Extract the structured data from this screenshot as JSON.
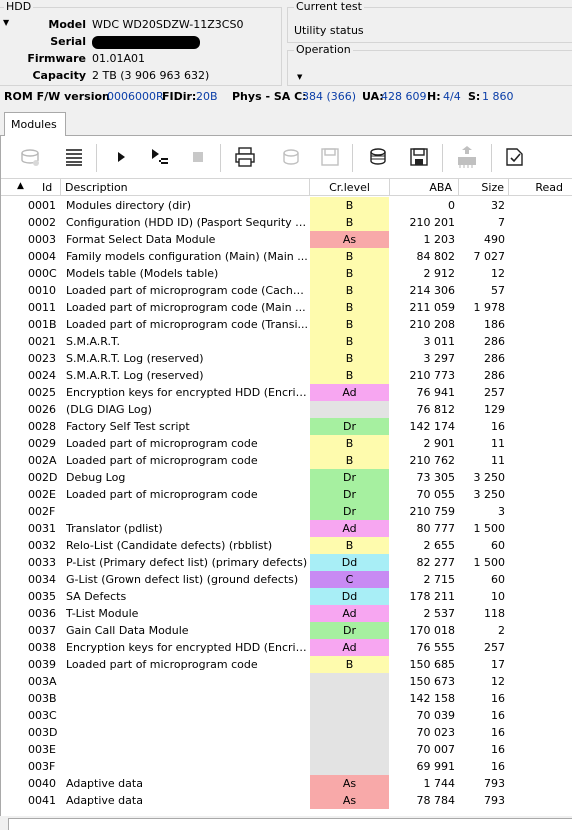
{
  "hdd": {
    "title": "HDD",
    "model_label": "Model",
    "model": "WDC WD20SDZW-11Z3CS0",
    "serial_label": "Serial",
    "firmware_label": "Firmware",
    "firmware": "01.01A01",
    "capacity_label": "Capacity",
    "capacity": "2 TB (3 906 963 632)"
  },
  "current_test": {
    "title": "Current test",
    "status": "Utility status"
  },
  "operation": {
    "title": "Operation"
  },
  "fw": {
    "rom_label": "ROM F/W version",
    "rom": "0006000R",
    "fdir_label": "FIDir:",
    "fdir": "20B",
    "phys_label": "Phys - SA C:",
    "phys": "384 (366)",
    "ua_label": "UA:",
    "ua": "428 609",
    "h_label": "H:",
    "h": "4/4",
    "s_label": "S:",
    "s": "1 860"
  },
  "tabs": {
    "modules": "Modules"
  },
  "toolbar": {
    "buttons": [
      "disk-read-icon",
      "list-icon",
      "play-icon",
      "step-icon",
      "stop-icon",
      "print-icon",
      "disk-open-icon",
      "disk-save-icon",
      "chip-read-icon",
      "chip-save-icon",
      "chip-write-icon",
      "checklist-icon"
    ]
  },
  "table": {
    "headers": {
      "id": "Id",
      "desc": "Description",
      "lvl": "Cr.level",
      "aba": "ABA",
      "size": "Size",
      "read": "Read"
    },
    "level_colors": {
      "B": "#fefbad",
      "As": "#f8a9a9",
      "Ad": "#f7a6f1",
      "Dr": "#a6f0a0",
      "Dd": "#a8eef6",
      "C": "#c88af3",
      "": "#e3e3e3"
    },
    "rows": [
      {
        "id": "0001",
        "desc": "Modules directory (dir)",
        "lvl": "B",
        "aba": "0",
        "size": "32"
      },
      {
        "id": "0002",
        "desc": "Configuration (HDD ID) (Pasport Sequrity B...",
        "lvl": "B",
        "aba": "210 201",
        "size": "7"
      },
      {
        "id": "0003",
        "desc": "Format Select Data Module",
        "lvl": "As",
        "aba": "1 203",
        "size": "490"
      },
      {
        "id": "0004",
        "desc": "Family models configuration (Main) (Main ...",
        "lvl": "B",
        "aba": "84 802",
        "size": "7 027"
      },
      {
        "id": "000C",
        "desc": "Models table (Models table)",
        "lvl": "B",
        "aba": "2 912",
        "size": "12"
      },
      {
        "id": "0010",
        "desc": "Loaded part of microprogram code (Cache ...",
        "lvl": "B",
        "aba": "214 306",
        "size": "57"
      },
      {
        "id": "0011",
        "desc": "Loaded part of microprogram code (Main ...",
        "lvl": "B",
        "aba": "211 059",
        "size": "1 978"
      },
      {
        "id": "001B",
        "desc": "Loaded part of microprogram code (Transi...",
        "lvl": "B",
        "aba": "210 208",
        "size": "186"
      },
      {
        "id": "0021",
        "desc": "S.M.A.R.T.",
        "lvl": "B",
        "aba": "3 011",
        "size": "286"
      },
      {
        "id": "0023",
        "desc": "S.M.A.R.T. Log (reserved)",
        "lvl": "B",
        "aba": "3 297",
        "size": "286"
      },
      {
        "id": "0024",
        "desc": "S.M.A.R.T. Log (reserved)",
        "lvl": "B",
        "aba": "210 773",
        "size": "286"
      },
      {
        "id": "0025",
        "desc": "Encryption keys for encrypted HDD (Encript...",
        "lvl": "Ad",
        "aba": "76 941",
        "size": "257"
      },
      {
        "id": "0026",
        "desc": " (DLG DIAG Log)",
        "lvl": "",
        "aba": "76 812",
        "size": "129"
      },
      {
        "id": "0028",
        "desc": "Factory Self Test script",
        "lvl": "Dr",
        "aba": "142 174",
        "size": "16"
      },
      {
        "id": "0029",
        "desc": "Loaded part of microprogram code",
        "lvl": "B",
        "aba": "2 901",
        "size": "11"
      },
      {
        "id": "002A",
        "desc": "Loaded part of microprogram code",
        "lvl": "B",
        "aba": "210 762",
        "size": "11"
      },
      {
        "id": "002D",
        "desc": "Debug Log",
        "lvl": "Dr",
        "aba": "73 305",
        "size": "3 250"
      },
      {
        "id": "002E",
        "desc": "Loaded part of microprogram code",
        "lvl": "Dr",
        "aba": "70 055",
        "size": "3 250"
      },
      {
        "id": "002F",
        "desc": "",
        "lvl": "Dr",
        "aba": "210 759",
        "size": "3"
      },
      {
        "id": "0031",
        "desc": "Translator (pdlist)",
        "lvl": "Ad",
        "aba": "80 777",
        "size": "1 500"
      },
      {
        "id": "0032",
        "desc": "Relo-List (Candidate defects) (rbblist)",
        "lvl": "B",
        "aba": "2 655",
        "size": "60"
      },
      {
        "id": "0033",
        "desc": "P-List (Primary defect list) (primary defects)",
        "lvl": "Dd",
        "aba": "82 277",
        "size": "1 500"
      },
      {
        "id": "0034",
        "desc": "G-List (Grown defect list) (ground defects)",
        "lvl": "C",
        "aba": "2 715",
        "size": "60"
      },
      {
        "id": "0035",
        "desc": "SA Defects",
        "lvl": "Dd",
        "aba": "178 211",
        "size": "10"
      },
      {
        "id": "0036",
        "desc": "T-List Module",
        "lvl": "Ad",
        "aba": "2 537",
        "size": "118"
      },
      {
        "id": "0037",
        "desc": "Gain Call Data Module",
        "lvl": "Dr",
        "aba": "170 018",
        "size": "2"
      },
      {
        "id": "0038",
        "desc": "Encryption keys for encrypted HDD (Encript...",
        "lvl": "Ad",
        "aba": "76 555",
        "size": "257"
      },
      {
        "id": "0039",
        "desc": "Loaded part of microprogram code",
        "lvl": "B",
        "aba": "150 685",
        "size": "17"
      },
      {
        "id": "003A",
        "desc": "",
        "lvl": "",
        "aba": "150 673",
        "size": "12"
      },
      {
        "id": "003B",
        "desc": "",
        "lvl": "",
        "aba": "142 158",
        "size": "16"
      },
      {
        "id": "003C",
        "desc": "",
        "lvl": "",
        "aba": "70 039",
        "size": "16"
      },
      {
        "id": "003D",
        "desc": "",
        "lvl": "",
        "aba": "70 023",
        "size": "16"
      },
      {
        "id": "003E",
        "desc": "",
        "lvl": "",
        "aba": "70 007",
        "size": "16"
      },
      {
        "id": "003F",
        "desc": "",
        "lvl": "",
        "aba": "69 991",
        "size": "16"
      },
      {
        "id": "0040",
        "desc": "Adaptive data",
        "lvl": "As",
        "aba": "1 744",
        "size": "793"
      },
      {
        "id": "0041",
        "desc": "Adaptive data",
        "lvl": "As",
        "aba": "78 784",
        "size": "793"
      }
    ]
  }
}
